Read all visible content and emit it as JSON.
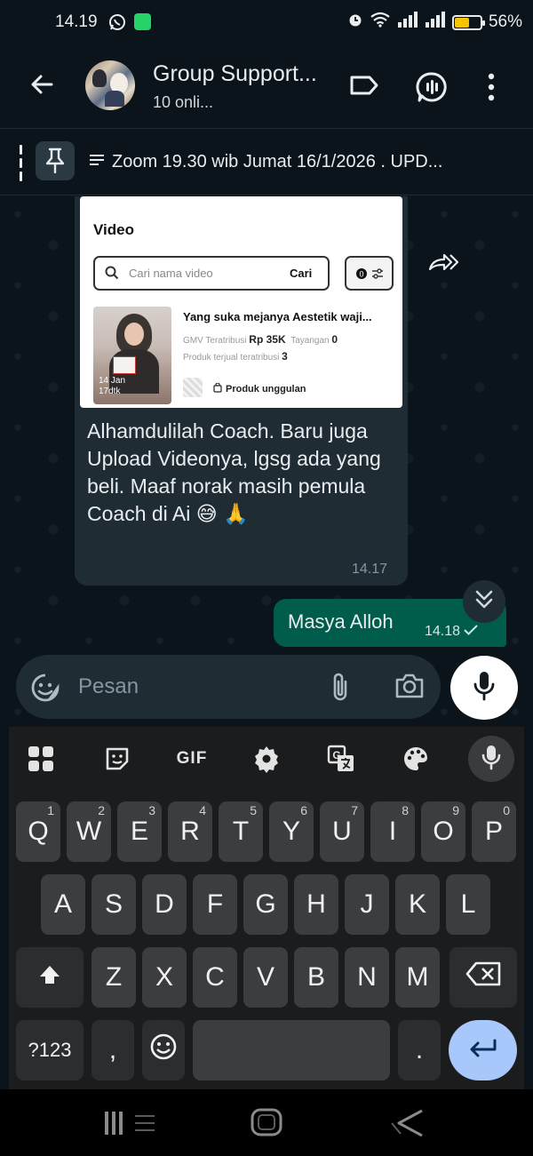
{
  "status_bar": {
    "time": "14.19",
    "battery": "56%",
    "battery_level": 0.56
  },
  "header": {
    "title": "Group Support...",
    "subtitle": "10 onli..."
  },
  "pinned": {
    "text": "Zoom 19.30 wib Jumat 16/1/2026 . UPD..."
  },
  "messages": {
    "incoming": {
      "card": {
        "title": "Video",
        "search_placeholder": "Cari nama video",
        "search_button": "Cari",
        "thumb_caption_1": "14 Jan",
        "thumb_caption_2": "17dtk",
        "video_title": "Yang suka mejanya Aestetik waji...",
        "gmv_label": "GMV Teratribusi",
        "gmv_value": "Rp 35K",
        "views_label": "Tayangan",
        "views_value": "0",
        "sold_label": "Produk terjual teratribusi",
        "sold_value": "3",
        "product_label": "Produk unggulan"
      },
      "text": "Alhamdulilah Coach. Baru juga Upload Videonya, lgsg ada yang beli. Maaf norak masih pemula Coach di Ai 😅 🙏",
      "time": "14.17"
    },
    "outgoing": {
      "text": "Masya Alloh",
      "time": "14.18"
    }
  },
  "input": {
    "placeholder": "Pesan"
  },
  "keyboard": {
    "gif_label": "GIF",
    "row1": [
      {
        "k": "Q",
        "h": "1"
      },
      {
        "k": "W",
        "h": "2"
      },
      {
        "k": "E",
        "h": "3"
      },
      {
        "k": "R",
        "h": "4"
      },
      {
        "k": "T",
        "h": "5"
      },
      {
        "k": "Y",
        "h": "6"
      },
      {
        "k": "U",
        "h": "7"
      },
      {
        "k": "I",
        "h": "8"
      },
      {
        "k": "O",
        "h": "9"
      },
      {
        "k": "P",
        "h": "0"
      }
    ],
    "row2": [
      "A",
      "S",
      "D",
      "F",
      "G",
      "H",
      "J",
      "K",
      "L"
    ],
    "row3": [
      "Z",
      "X",
      "C",
      "V",
      "B",
      "N",
      "M"
    ],
    "symbols_label": "?123",
    "comma_label": ",",
    "period_label": "."
  },
  "colors": {
    "accent_green": "#25d366",
    "outgoing_bubble": "#005c4b",
    "incoming_bubble": "#1f2c34",
    "enter_key": "#a8c7fa"
  }
}
